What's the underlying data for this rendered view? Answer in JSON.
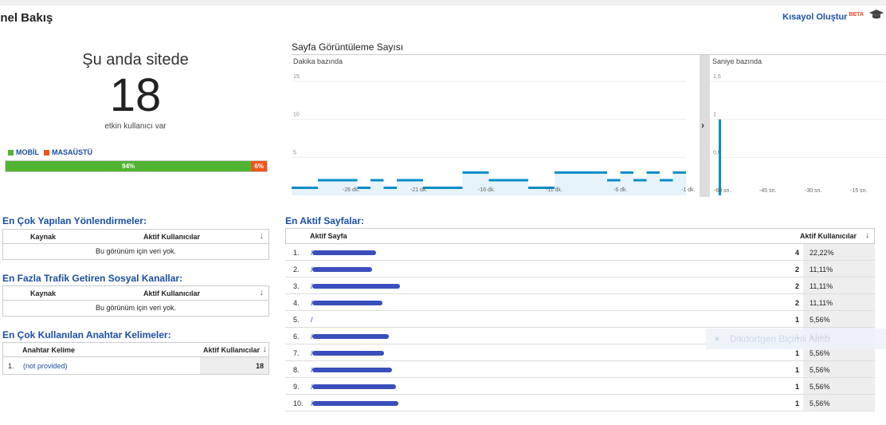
{
  "header": {
    "title": "enel Bakış",
    "shortcut_label": "Kısayol Oluştur",
    "beta_label": "BETA"
  },
  "active_now": {
    "label": "Şu anda sitede",
    "count": "18",
    "sub": "etkin kullanıcı var",
    "legend": [
      {
        "name": "MOBİL",
        "color": "#50b432"
      },
      {
        "name": "MASAÜSTÜ",
        "color": "#ed561b"
      }
    ],
    "split": [
      {
        "label": "94%",
        "value": 94,
        "color": "#50b432"
      },
      {
        "label": "6%",
        "value": 6,
        "color": "#ed561b"
      }
    ]
  },
  "chart": {
    "title": "Sayfa Görüntüleme Sayısı",
    "left_label": "Dakika bazında",
    "right_label": "Saniye bazında",
    "left_y_ticks": [
      "15",
      "10",
      "5"
    ],
    "right_y_ticks": [
      "1,5",
      "1",
      "0,5"
    ],
    "left_x_ticks": [
      "-26 dk.",
      "-21 dk.",
      "-16 dk.",
      "-11 dk.",
      "-6 dk.",
      "-1 dk."
    ],
    "right_x_ticks": [
      "-60 sn.",
      "-45 sn.",
      "-30 sn.",
      "-15 sn."
    ],
    "expand_arrow": "›"
  },
  "chart_data": [
    {
      "type": "area",
      "title": "Dakika bazında",
      "x": [
        -30,
        -29,
        -28,
        -27,
        -26,
        -25,
        -24,
        -23,
        -22,
        -21,
        -20,
        -19,
        -18,
        -17,
        -16,
        -15,
        -14,
        -13,
        -12,
        -11,
        -10,
        -9,
        -8,
        -7,
        -6,
        -5,
        -4,
        -3,
        -2,
        -1
      ],
      "values": [
        1,
        1,
        2,
        2,
        2,
        1,
        2,
        1,
        2,
        2,
        1,
        1,
        1,
        3,
        3,
        2,
        2,
        2,
        1,
        1,
        3,
        3,
        3,
        3,
        2,
        3,
        2,
        3,
        2,
        3
      ],
      "ylim": [
        0,
        17
      ]
    },
    {
      "type": "bar",
      "title": "Saniye bazında",
      "x": [
        -60,
        -59
      ],
      "values": [
        1,
        0
      ],
      "ylim": [
        0,
        1.7
      ]
    }
  ],
  "referrals": {
    "title": "En Çok Yapılan Yönlendirmeler:",
    "col1": "Kaynak",
    "col2": "Aktif Kullanıcılar",
    "empty": "Bu görünüm için veri yok."
  },
  "social": {
    "title": "En Fazla Trafik Getiren Sosyal Kanallar:",
    "col1": "Kaynak",
    "col2": "Aktif Kullanıcılar",
    "empty": "Bu görünüm için veri yok."
  },
  "keywords": {
    "title": "En Çok Kullanılan Anahtar Kelimeler:",
    "col1": "Anahtar Kelime",
    "col2": "Aktif Kullanıcılar",
    "rows": [
      {
        "idx": "1.",
        "keyword": "(not provided)",
        "count": "18"
      }
    ]
  },
  "pages": {
    "title": "En Aktif Sayfalar:",
    "col1": "Aktif Sayfa",
    "col2": "Aktif Kullanıcılar",
    "rows": [
      {
        "idx": "1.",
        "path": "/",
        "count": "4",
        "pct": "22,22%"
      },
      {
        "idx": "2.",
        "path": "/",
        "count": "2",
        "pct": "11,11%"
      },
      {
        "idx": "3.",
        "path": "/",
        "count": "2",
        "pct": "11,11%"
      },
      {
        "idx": "4.",
        "path": "/",
        "count": "2",
        "pct": "11,11%"
      },
      {
        "idx": "5.",
        "path": "/",
        "count": "1",
        "pct": "5,56%"
      },
      {
        "idx": "6.",
        "path": "/",
        "count": "1",
        "pct": "5,56%"
      },
      {
        "idx": "7.",
        "path": "/",
        "count": "1",
        "pct": "5,56%"
      },
      {
        "idx": "8.",
        "path": "/",
        "count": "1",
        "pct": "5,56%"
      },
      {
        "idx": "9.",
        "path": "/",
        "count": "1",
        "pct": "5,56%"
      },
      {
        "idx": "10.",
        "path": "/",
        "count": "1",
        "pct": "5,56%"
      }
    ]
  },
  "overlay": {
    "label": "Dikdörtgen Biçimli Alıntı"
  },
  "colors": {
    "link": "#1a4fa3",
    "series": "#058dc7",
    "series_fill": "#e6f3fa"
  }
}
